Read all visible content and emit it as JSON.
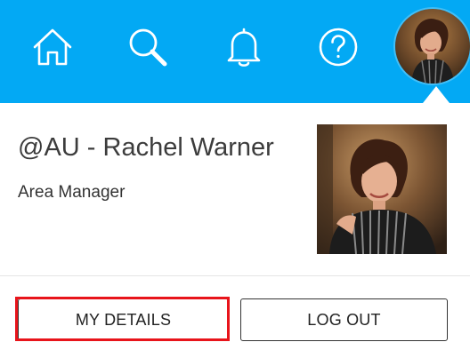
{
  "header": {
    "background_color": "#03A9F4",
    "icons": [
      {
        "name": "home-icon"
      },
      {
        "name": "search-icon"
      },
      {
        "name": "bell-icon"
      },
      {
        "name": "help-icon"
      }
    ]
  },
  "profile": {
    "name": "@AU - Rachel Warner",
    "role": "Area Manager"
  },
  "actions": {
    "my_details_label": "MY DETAILS",
    "logout_label": "LOG OUT",
    "highlight_color": "#e8141b"
  }
}
